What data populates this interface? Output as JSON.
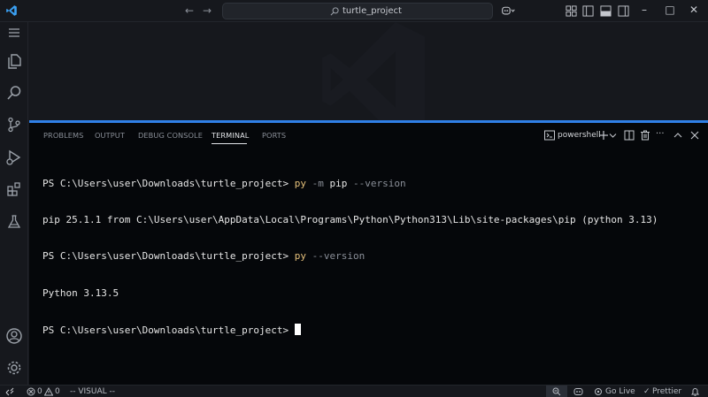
{
  "titlebar": {
    "search_text": "turtle_project",
    "back_glyph": "←",
    "forward_glyph": "→",
    "minimize_glyph": "–",
    "maximize_glyph": "□",
    "close_glyph": "✕"
  },
  "activitybar": {
    "items": [
      "menu-icon",
      "explorer-icon",
      "search-icon",
      "source-control-icon",
      "run-debug-icon",
      "extensions-icon",
      "testing-icon"
    ],
    "bottom": [
      "account-icon",
      "manage-gear-icon"
    ]
  },
  "panel": {
    "tabs": [
      {
        "label": "PROBLEMS",
        "active": false
      },
      {
        "label": "OUTPUT",
        "active": false
      },
      {
        "label": "DEBUG CONSOLE",
        "active": false
      },
      {
        "label": "TERMINAL",
        "active": true
      },
      {
        "label": "PORTS",
        "active": false
      }
    ],
    "shell_name": "powershell",
    "accent": "#2f7fe6"
  },
  "terminal": {
    "prompt1": "PS C:\\Users\\user\\Downloads\\turtle_project> ",
    "cmd1_name": "py",
    "cmd1_args": " -m ",
    "cmd1_pip": "pip",
    "cmd1_flag": " --version",
    "out1": "pip 25.1.1 from C:\\Users\\user\\AppData\\Local\\Programs\\Python\\Python313\\Lib\\site-packages\\pip (python 3.13)",
    "prompt2": "PS C:\\Users\\user\\Downloads\\turtle_project> ",
    "cmd2_name": "py",
    "cmd2_args": " --version",
    "out2": "Python 3.13.5",
    "prompt3": "PS C:\\Users\\user\\Downloads\\turtle_project> "
  },
  "statusbar": {
    "errors": "0",
    "warnings": "0",
    "mode": "-- VISUAL --",
    "go_live": "Go Live",
    "prettier": "Prettier"
  }
}
